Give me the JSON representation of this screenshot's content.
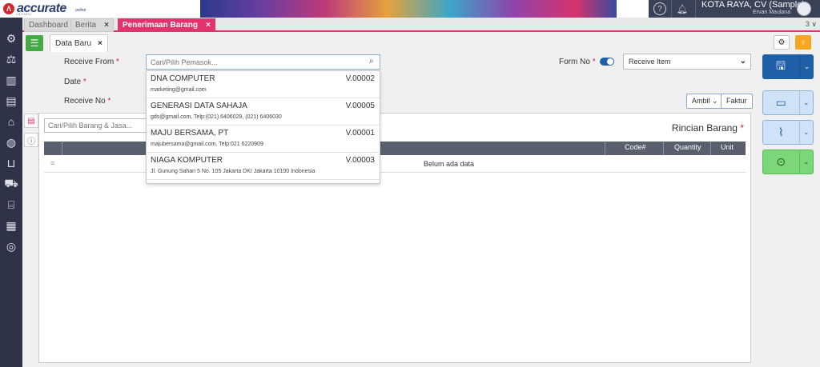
{
  "app": {
    "logo_text": "accurate",
    "logo_sub": "online",
    "version": "v 5.0.1874"
  },
  "header": {
    "company": "KOTA RAYA, CV (Sample)",
    "user": "Ervan Maulana"
  },
  "tabs": [
    {
      "label": "Dashboard"
    },
    {
      "label": "Berita",
      "closable": "×"
    },
    {
      "label": "Penerimaan Barang",
      "closable": "×"
    }
  ],
  "tab_count": "3",
  "subtab": {
    "label": "Data Baru",
    "close": "×"
  },
  "form": {
    "receive_from_label": "Receive From",
    "date_label": "Date",
    "receive_no_label": "Receive No",
    "required_mark": "*",
    "search_placeholder": "Cari/Pilih Pemasok...",
    "form_no_label": "Form No",
    "form_type": "Receive Item",
    "ambil_label": "Ambil",
    "faktur_label": "Faktur"
  },
  "suppliers": [
    {
      "name": "DNA COMPUTER",
      "code": "V.00002",
      "detail": "marketing@gmail.com"
    },
    {
      "name": "GENERASI DATA SAHAJA",
      "code": "V.00005",
      "detail": "gds@gmail.com, Telp:(021) 6406029, (021) 6406030"
    },
    {
      "name": "MAJU BERSAMA, PT",
      "code": "V.00001",
      "detail": "majubersama@gmail.com, Telp:021 6220909"
    },
    {
      "name": "NIAGA KOMPUTER",
      "code": "V.00003",
      "detail": "Jl. Gunung Sahari 5 No. 105 Jakarta DKI Jakarta 10100 Indonesia"
    }
  ],
  "items_panel": {
    "search_placeholder": "Cari/Pilih Barang & Jasa...",
    "title": "Rincian Barang",
    "columns": {
      "code": "Code#",
      "quantity": "Quantity",
      "unit": "Unit"
    },
    "empty_text": "Belum ada data"
  },
  "colors": {
    "accent": "#e2336f",
    "save": "#1e5fa8",
    "doc": "#cfe2f8",
    "more": "#7cd67a"
  }
}
